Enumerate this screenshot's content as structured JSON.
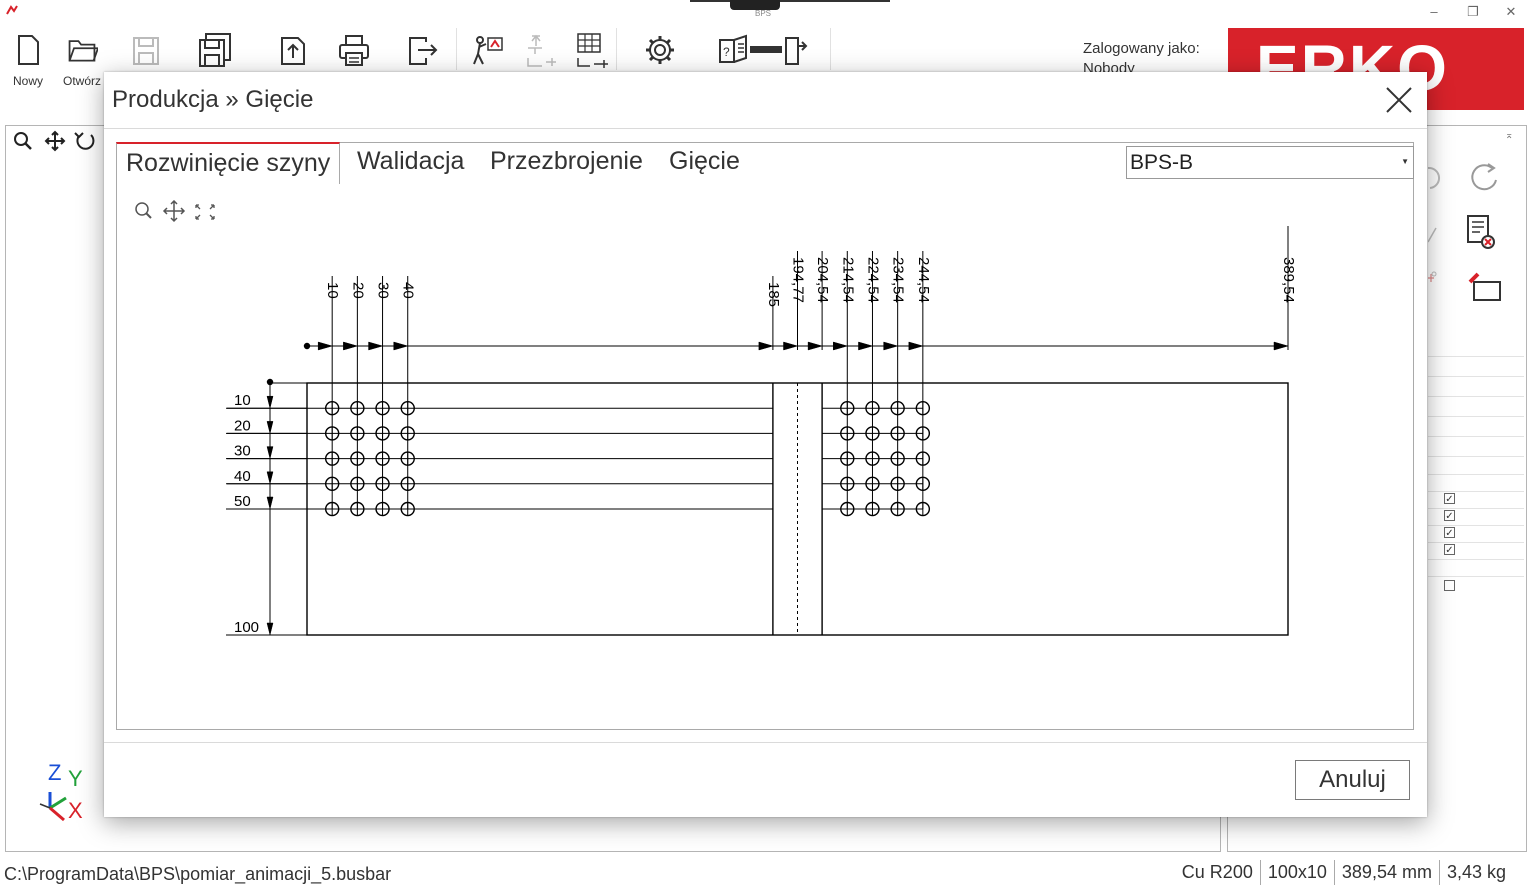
{
  "window": {
    "bps_label": "BPS",
    "minimize": "–",
    "restore": "❐",
    "close": "✕"
  },
  "toolbar": {
    "items": [
      {
        "label": "Nowy",
        "icon": "new-document-icon"
      },
      {
        "label": "Otwórz",
        "icon": "open-folder-icon"
      },
      {
        "label": "",
        "icon": "save-icon-disabled"
      },
      {
        "label": "",
        "icon": "save-as-icon"
      },
      {
        "label": "",
        "icon": "export-icon"
      },
      {
        "label": "",
        "icon": "print-icon"
      },
      {
        "label": "",
        "icon": "exit-icon"
      },
      {
        "label": "",
        "icon": "production-person-icon"
      },
      {
        "label": "",
        "icon": "upload-machine-icon-disabled"
      },
      {
        "label": "",
        "icon": "table-machine-icon"
      },
      {
        "label": "",
        "icon": "settings-gear-icon"
      },
      {
        "label": "",
        "icon": "manual-door-icon"
      }
    ],
    "login_label": "Zalogowany jako:",
    "login_user": "Nobody",
    "brand": "ERKO"
  },
  "viewport": {
    "tools": [
      "magnify-icon",
      "pan-icon",
      "rotate-icon"
    ],
    "axis": {
      "z": "Z",
      "y": "Y",
      "x": "X"
    }
  },
  "status_bar": {
    "path": "C:\\ProgramData\\BPS\\pomiar_animacji_5.busbar",
    "material": "Cu R200",
    "section": "100x10",
    "length": "389,54 mm",
    "weight": "3,43 kg"
  },
  "dialog": {
    "title": "Produkcja » Gięcie",
    "tabs": [
      "Rozwinięcie szyny",
      "Walidacja",
      "Przezbrojenie",
      "Gięcie"
    ],
    "active_tab": 0,
    "combo_value": "BPS-B",
    "cancel": "Anuluj",
    "drawing_tools": [
      "magnify-icon",
      "pan-icon",
      "fit-screen-icon"
    ]
  },
  "chart_data": {
    "type": "technical-drawing",
    "units": "mm",
    "bar_length": 389.54,
    "bar_width": 100,
    "x_dimensions": [
      "10",
      "20",
      "30",
      "40",
      "185",
      "194,77",
      "204,54",
      "214,54",
      "224,54",
      "234,54",
      "244,54",
      "389,54"
    ],
    "y_dimensions": [
      "10",
      "20",
      "30",
      "40",
      "50",
      "100"
    ],
    "bend_lines_x": [
      185,
      204.54
    ],
    "bend_center_x": 194.77,
    "hole_columns_x": [
      10,
      20,
      30,
      40,
      214.54,
      224.54,
      234.54,
      244.54
    ],
    "hole_rows_y": [
      10,
      20,
      30,
      40,
      50
    ]
  }
}
